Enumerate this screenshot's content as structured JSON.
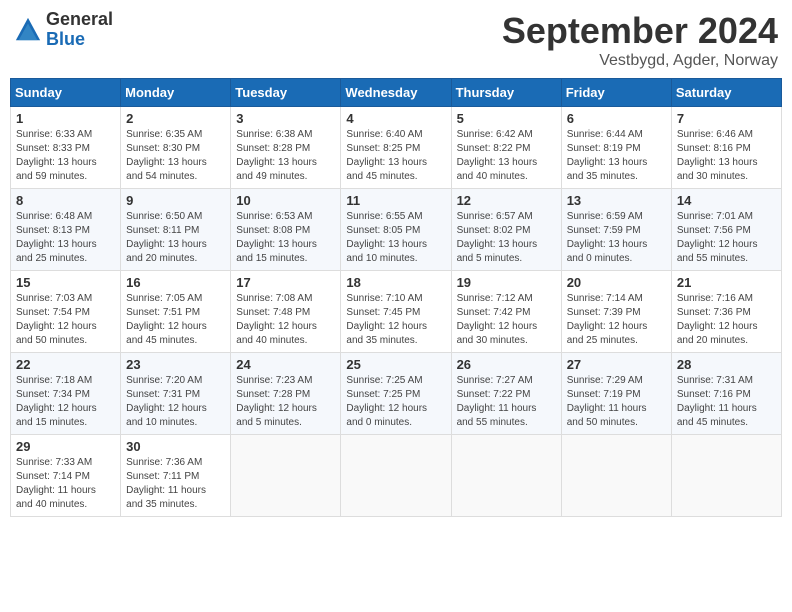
{
  "header": {
    "logo_general": "General",
    "logo_blue": "Blue",
    "title": "September 2024",
    "location": "Vestbygd, Agder, Norway"
  },
  "days_of_week": [
    "Sunday",
    "Monday",
    "Tuesday",
    "Wednesday",
    "Thursday",
    "Friday",
    "Saturday"
  ],
  "weeks": [
    [
      {
        "day": "1",
        "info": "Sunrise: 6:33 AM\nSunset: 8:33 PM\nDaylight: 13 hours\nand 59 minutes."
      },
      {
        "day": "2",
        "info": "Sunrise: 6:35 AM\nSunset: 8:30 PM\nDaylight: 13 hours\nand 54 minutes."
      },
      {
        "day": "3",
        "info": "Sunrise: 6:38 AM\nSunset: 8:28 PM\nDaylight: 13 hours\nand 49 minutes."
      },
      {
        "day": "4",
        "info": "Sunrise: 6:40 AM\nSunset: 8:25 PM\nDaylight: 13 hours\nand 45 minutes."
      },
      {
        "day": "5",
        "info": "Sunrise: 6:42 AM\nSunset: 8:22 PM\nDaylight: 13 hours\nand 40 minutes."
      },
      {
        "day": "6",
        "info": "Sunrise: 6:44 AM\nSunset: 8:19 PM\nDaylight: 13 hours\nand 35 minutes."
      },
      {
        "day": "7",
        "info": "Sunrise: 6:46 AM\nSunset: 8:16 PM\nDaylight: 13 hours\nand 30 minutes."
      }
    ],
    [
      {
        "day": "8",
        "info": "Sunrise: 6:48 AM\nSunset: 8:13 PM\nDaylight: 13 hours\nand 25 minutes."
      },
      {
        "day": "9",
        "info": "Sunrise: 6:50 AM\nSunset: 8:11 PM\nDaylight: 13 hours\nand 20 minutes."
      },
      {
        "day": "10",
        "info": "Sunrise: 6:53 AM\nSunset: 8:08 PM\nDaylight: 13 hours\nand 15 minutes."
      },
      {
        "day": "11",
        "info": "Sunrise: 6:55 AM\nSunset: 8:05 PM\nDaylight: 13 hours\nand 10 minutes."
      },
      {
        "day": "12",
        "info": "Sunrise: 6:57 AM\nSunset: 8:02 PM\nDaylight: 13 hours\nand 5 minutes."
      },
      {
        "day": "13",
        "info": "Sunrise: 6:59 AM\nSunset: 7:59 PM\nDaylight: 13 hours\nand 0 minutes."
      },
      {
        "day": "14",
        "info": "Sunrise: 7:01 AM\nSunset: 7:56 PM\nDaylight: 12 hours\nand 55 minutes."
      }
    ],
    [
      {
        "day": "15",
        "info": "Sunrise: 7:03 AM\nSunset: 7:54 PM\nDaylight: 12 hours\nand 50 minutes."
      },
      {
        "day": "16",
        "info": "Sunrise: 7:05 AM\nSunset: 7:51 PM\nDaylight: 12 hours\nand 45 minutes."
      },
      {
        "day": "17",
        "info": "Sunrise: 7:08 AM\nSunset: 7:48 PM\nDaylight: 12 hours\nand 40 minutes."
      },
      {
        "day": "18",
        "info": "Sunrise: 7:10 AM\nSunset: 7:45 PM\nDaylight: 12 hours\nand 35 minutes."
      },
      {
        "day": "19",
        "info": "Sunrise: 7:12 AM\nSunset: 7:42 PM\nDaylight: 12 hours\nand 30 minutes."
      },
      {
        "day": "20",
        "info": "Sunrise: 7:14 AM\nSunset: 7:39 PM\nDaylight: 12 hours\nand 25 minutes."
      },
      {
        "day": "21",
        "info": "Sunrise: 7:16 AM\nSunset: 7:36 PM\nDaylight: 12 hours\nand 20 minutes."
      }
    ],
    [
      {
        "day": "22",
        "info": "Sunrise: 7:18 AM\nSunset: 7:34 PM\nDaylight: 12 hours\nand 15 minutes."
      },
      {
        "day": "23",
        "info": "Sunrise: 7:20 AM\nSunset: 7:31 PM\nDaylight: 12 hours\nand 10 minutes."
      },
      {
        "day": "24",
        "info": "Sunrise: 7:23 AM\nSunset: 7:28 PM\nDaylight: 12 hours\nand 5 minutes."
      },
      {
        "day": "25",
        "info": "Sunrise: 7:25 AM\nSunset: 7:25 PM\nDaylight: 12 hours\nand 0 minutes."
      },
      {
        "day": "26",
        "info": "Sunrise: 7:27 AM\nSunset: 7:22 PM\nDaylight: 11 hours\nand 55 minutes."
      },
      {
        "day": "27",
        "info": "Sunrise: 7:29 AM\nSunset: 7:19 PM\nDaylight: 11 hours\nand 50 minutes."
      },
      {
        "day": "28",
        "info": "Sunrise: 7:31 AM\nSunset: 7:16 PM\nDaylight: 11 hours\nand 45 minutes."
      }
    ],
    [
      {
        "day": "29",
        "info": "Sunrise: 7:33 AM\nSunset: 7:14 PM\nDaylight: 11 hours\nand 40 minutes."
      },
      {
        "day": "30",
        "info": "Sunrise: 7:36 AM\nSunset: 7:11 PM\nDaylight: 11 hours\nand 35 minutes."
      },
      {
        "day": "",
        "info": ""
      },
      {
        "day": "",
        "info": ""
      },
      {
        "day": "",
        "info": ""
      },
      {
        "day": "",
        "info": ""
      },
      {
        "day": "",
        "info": ""
      }
    ]
  ]
}
